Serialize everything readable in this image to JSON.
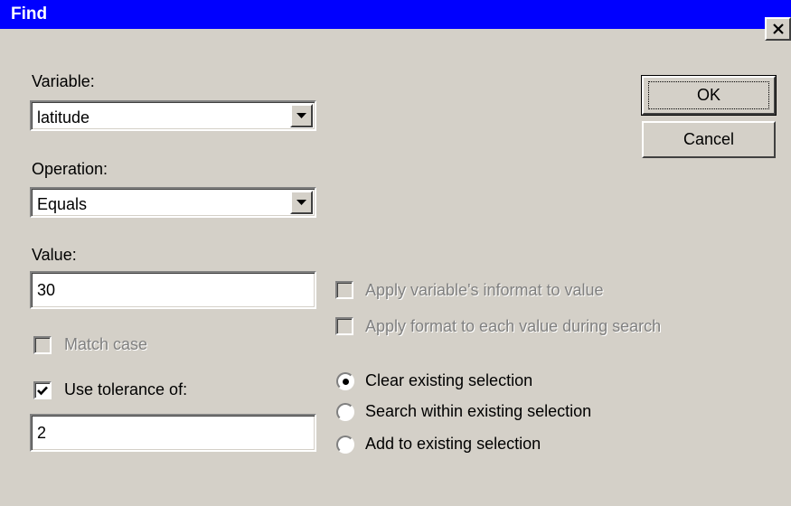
{
  "window": {
    "title": "Find"
  },
  "variable": {
    "label": "Variable:",
    "value": "latitude"
  },
  "operation": {
    "label": "Operation:",
    "value": "Equals"
  },
  "value_field": {
    "label": "Value:",
    "value": "30"
  },
  "match_case": {
    "label": "Match case",
    "checked": false,
    "enabled": false
  },
  "use_tolerance": {
    "label": "Use tolerance of:",
    "checked": true,
    "value": "2"
  },
  "apply_informat": {
    "label": "Apply variable's informat to value",
    "checked": false,
    "enabled": false
  },
  "apply_format": {
    "label": "Apply format to each value during search",
    "checked": false,
    "enabled": false
  },
  "selection_options": [
    {
      "label": "Clear existing selection",
      "selected": true
    },
    {
      "label": "Search within existing selection",
      "selected": false
    },
    {
      "label": "Add to existing selection",
      "selected": false
    }
  ],
  "buttons": {
    "ok": "OK",
    "cancel": "Cancel"
  }
}
